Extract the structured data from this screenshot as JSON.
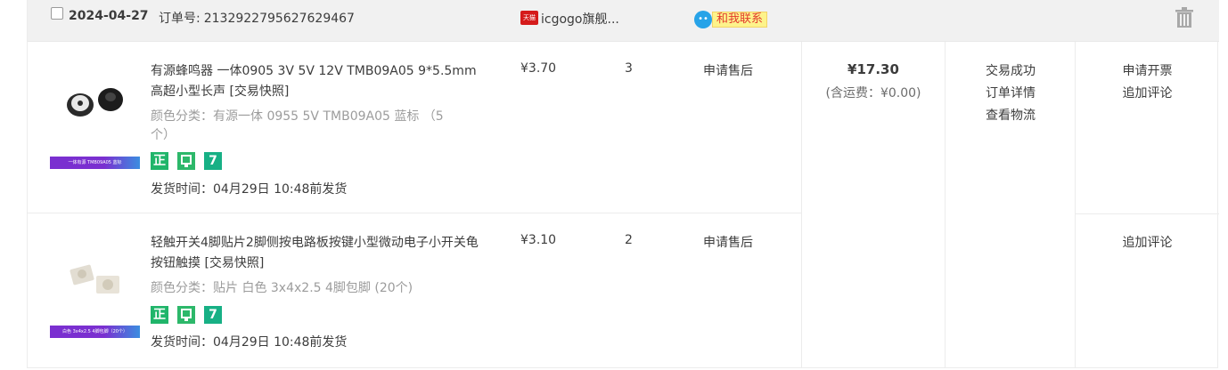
{
  "order": {
    "date": "2024-04-27",
    "order_no_label": "订单号:",
    "order_no": "2132922795627629467",
    "shop_icon_text": "天猫",
    "shop_name": "icgogo旗舰...",
    "contact_label": "和我联系",
    "total": "¥17.30",
    "shipping_note": "(含运费：¥0.00)",
    "status_lines": [
      "交易成功",
      "订单详情",
      "查看物流"
    ]
  },
  "items": [
    {
      "title": "有源蜂鸣器 一体0905 3V 5V 12V TMB09A05 9*5.5mm 高超小型长声 [交易快照]",
      "thumb_caption": "一体有源 TMB09A05 蓝标",
      "spec": "颜色分类：有源一体 0955 5V TMB09A05 蓝标 （5个）",
      "badges": [
        "正",
        "",
        "7"
      ],
      "ship_time": "发货时间：04月29日 10:48前发货",
      "price": "¥3.70",
      "qty": "3",
      "after_sale": "申请售后",
      "ops": [
        "申请开票",
        "追加评论"
      ]
    },
    {
      "title": "轻触开关4脚贴片2脚侧按电路板按键小型微动电子小开关龟按钮触摸 [交易快照]",
      "thumb_caption": "白色 3x4x2.5 4脚包脚（20个）",
      "spec": "颜色分类：贴片 白色 3x4x2.5 4脚包脚 (20个)",
      "badges": [
        "正",
        "",
        "7"
      ],
      "ship_time": "发货时间：04月29日 10:48前发货",
      "price": "¥3.10",
      "qty": "2",
      "after_sale": "申请售后",
      "ops": [
        "追加评论"
      ]
    }
  ],
  "colors": {
    "header_bg": "#f1f1f1",
    "badge_green": "#20b56a",
    "contact_bg": "#fdf38b",
    "contact_text": "#e23a2e",
    "tmall_red": "#d51b1b"
  },
  "icons": [
    "checkbox",
    "tmall-icon",
    "contact-icon",
    "trash-icon"
  ]
}
